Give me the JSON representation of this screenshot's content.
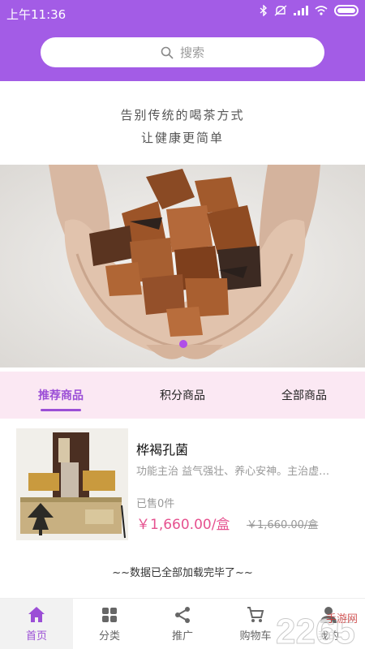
{
  "status_bar": {
    "time": "上午11:36"
  },
  "search": {
    "placeholder": "搜索"
  },
  "slogan": {
    "line1": "告别传统的喝茶方式",
    "line2": "让健康更简单"
  },
  "tabs": [
    {
      "label": "推荐商品",
      "active": true
    },
    {
      "label": "积分商品",
      "active": false
    },
    {
      "label": "全部商品",
      "active": false
    }
  ],
  "product": {
    "name": "桦褐孔菌",
    "description": "功能主治 益气强壮、养心安神。主治虚…",
    "sold": "已售0件",
    "price": "￥1,660.00/盒",
    "original_price": "￥1,660.00/盒"
  },
  "loaded_tip": "~~数据已全部加载完毕了~~",
  "nav": [
    {
      "label": "首页",
      "icon": "home-icon",
      "active": true
    },
    {
      "label": "分类",
      "icon": "grid-icon",
      "active": false
    },
    {
      "label": "推广",
      "icon": "share-icon",
      "active": false
    },
    {
      "label": "购物车",
      "icon": "cart-icon",
      "active": false
    },
    {
      "label": "我的",
      "icon": "user-icon",
      "active": false
    }
  ],
  "watermark": {
    "text": "2265",
    "subtext": "手游网"
  },
  "colors": {
    "brand": "#a35ce6",
    "accent": "#9b4ed6",
    "price": "#e6518f",
    "tab_bg": "#fbe8f3"
  }
}
